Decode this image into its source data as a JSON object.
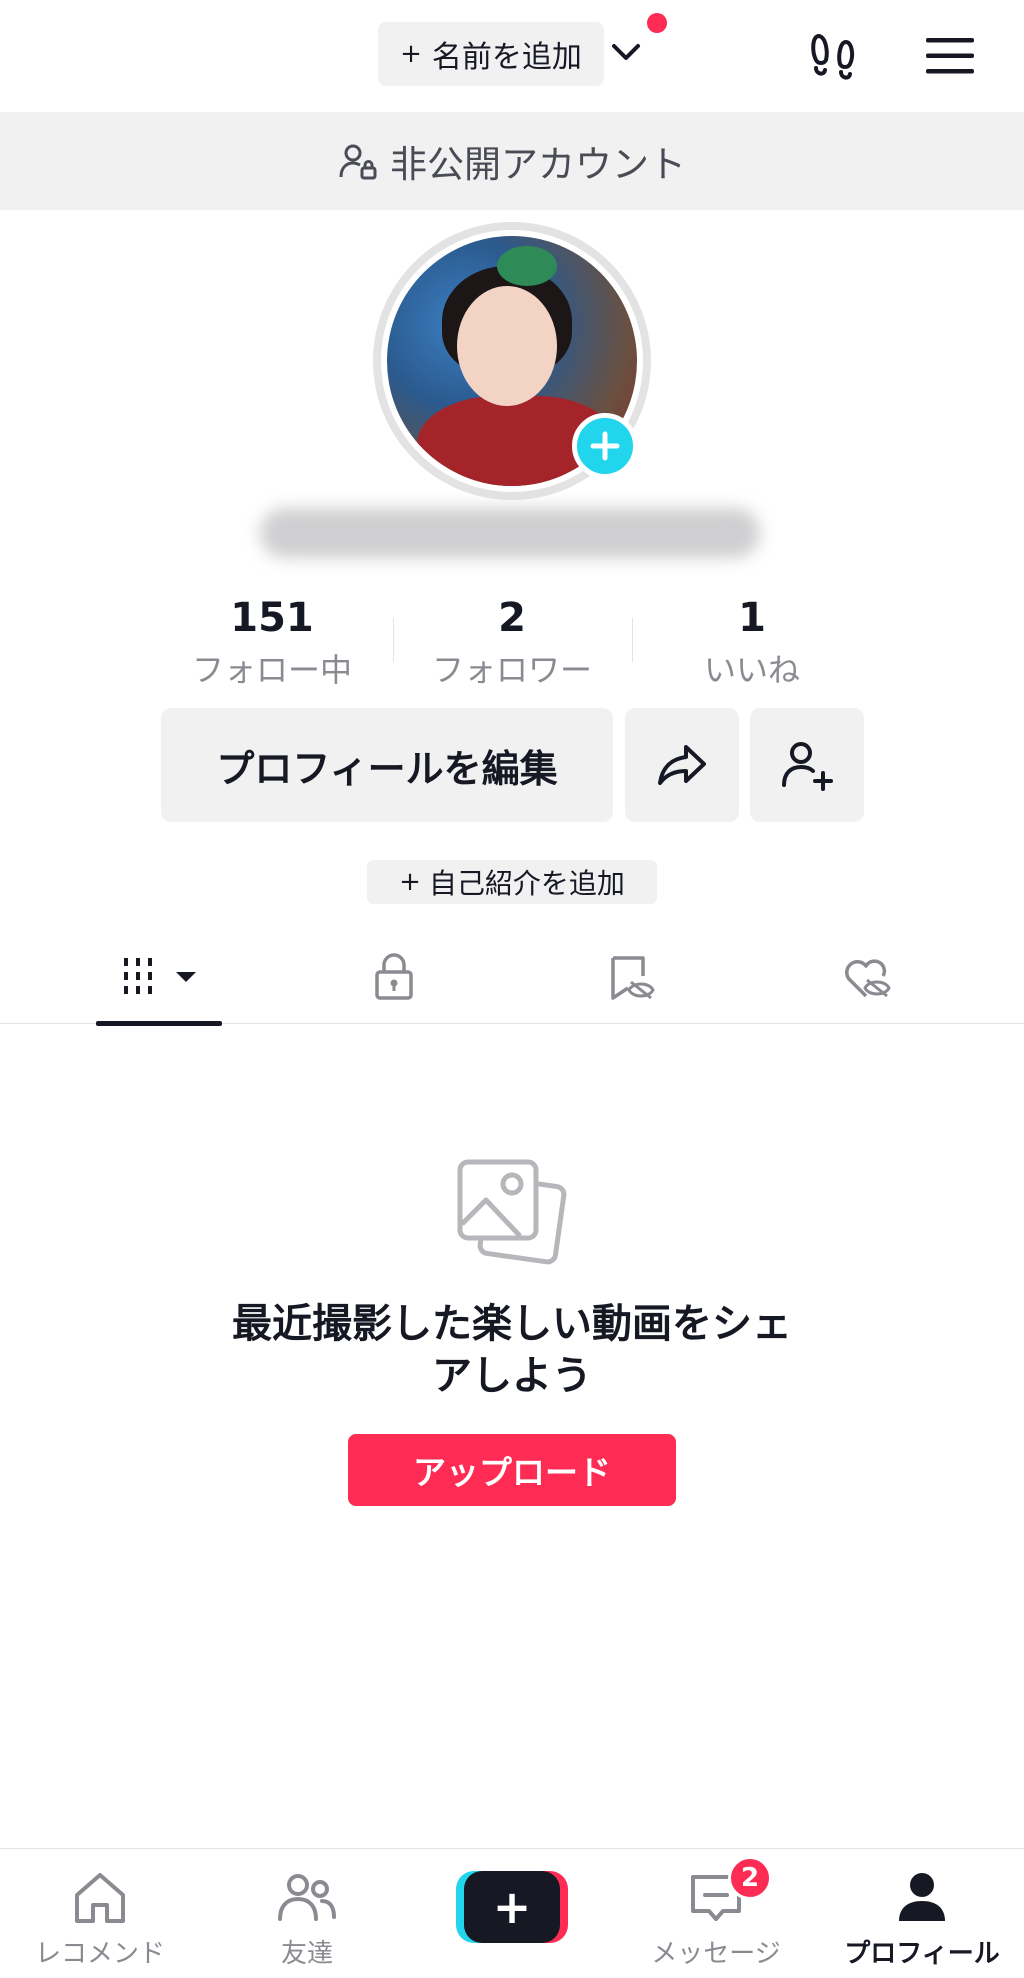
{
  "header": {
    "add_name_plus": "+",
    "add_name_label": "名前を追加"
  },
  "banner": {
    "private_account": "非公開アカウント"
  },
  "stats": [
    {
      "value": "151",
      "label": "フォロー中"
    },
    {
      "value": "2",
      "label": "フォロワー"
    },
    {
      "value": "1",
      "label": "いいね"
    }
  ],
  "actions": {
    "edit_profile": "プロフィールを編集",
    "add_bio_plus": "+",
    "add_bio": "自己紹介を追加"
  },
  "tabs": [
    {
      "icon": "grid-icon"
    },
    {
      "icon": "lock-icon"
    },
    {
      "icon": "bookmark-hidden-icon"
    },
    {
      "icon": "heart-hidden-icon"
    }
  ],
  "empty_state": {
    "line1": "最近撮影した楽しい動画をシェ",
    "line2": "アしよう",
    "upload_label": "アップロード"
  },
  "bottom_nav": [
    {
      "label": "レコメンド",
      "icon": "home-icon"
    },
    {
      "label": "友達",
      "icon": "friends-icon"
    },
    {
      "label": "",
      "icon": "create-icon"
    },
    {
      "label": "メッセージ",
      "icon": "inbox-icon",
      "badge": "2"
    },
    {
      "label": "プロフィール",
      "icon": "profile-icon",
      "active": true
    }
  ],
  "colors": {
    "accent": "#fe2c55",
    "cyan": "#20d5ec",
    "text": "#161823",
    "muted": "#8a8b91",
    "surface": "#f1f1f2"
  }
}
